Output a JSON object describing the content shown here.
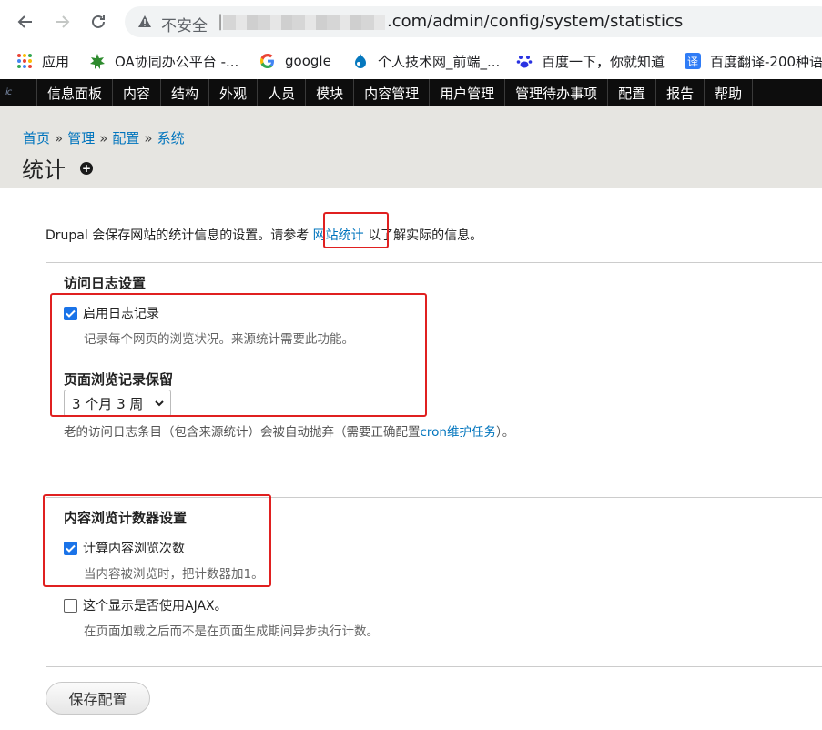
{
  "browser": {
    "insecure_label": "不安全",
    "url_separator": "|",
    "url_visible": ".com/admin/config/system/statistics",
    "bookmarks": [
      {
        "label": "应用",
        "icon": "apps-grid-icon"
      },
      {
        "label": "OA协同办公平台 -...",
        "icon": "oa-logo-icon"
      },
      {
        "label": "google",
        "icon": "google-logo-icon"
      },
      {
        "label": "个人技术网_前端_...",
        "icon": "drupal-drop-icon"
      },
      {
        "label": "百度一下，你就知道",
        "icon": "baidu-paw-icon"
      },
      {
        "label": "百度翻译-200种语",
        "icon": "baidu-translate-icon"
      }
    ],
    "translate_icon_text": "译",
    "colors": {
      "omnibox_bg": "#f1f3f4"
    }
  },
  "toolbar": {
    "logo": "ic",
    "items": [
      "信息面板",
      "内容",
      "结构",
      "外观",
      "人员",
      "模块",
      "内容管理",
      "用户管理",
      "管理待办事项",
      "配置",
      "报告",
      "帮助"
    ]
  },
  "header": {
    "breadcrumb": [
      "首页",
      "管理",
      "配置",
      "系统"
    ],
    "breadcrumb_separator": "»",
    "title": "统计",
    "shortcut_icon_text": "+"
  },
  "intro": {
    "before": "Drupal 会保存网站的统计信息的设置。请参考 ",
    "link": "网站统计",
    "after": " 以了解实际的信息。"
  },
  "access_log": {
    "legend": "访问日志设置",
    "enable_label": "启用日志记录",
    "enable_checked": true,
    "enable_desc": "记录每个网页的浏览状况。来源统计需要此功能。",
    "retention_label": "页面浏览记录保留",
    "retention_value": "3 个月 3 周",
    "retention_desc_before": "老的访问日志条目（包含来源统计）会被自动抛弃（需要正确配置",
    "retention_desc_link": "cron维护任务",
    "retention_desc_after": "）。"
  },
  "content_counter": {
    "legend": "内容浏览计数器设置",
    "count_label": "计算内容浏览次数",
    "count_checked": true,
    "count_desc": "当内容被浏览时，把计数器加1。",
    "ajax_label": "这个显示是否使用AJAX。",
    "ajax_checked": false,
    "ajax_desc": "在页面加载之后而不是在页面生成期间异步执行计数。"
  },
  "actions": {
    "save_label": "保存配置"
  },
  "colors": {
    "link": "#0074bd",
    "checkbox": "#1a73e8",
    "annotation": "#e02020",
    "toolbar": "#0d0d0d",
    "header_bg": "#e6e5e1"
  }
}
